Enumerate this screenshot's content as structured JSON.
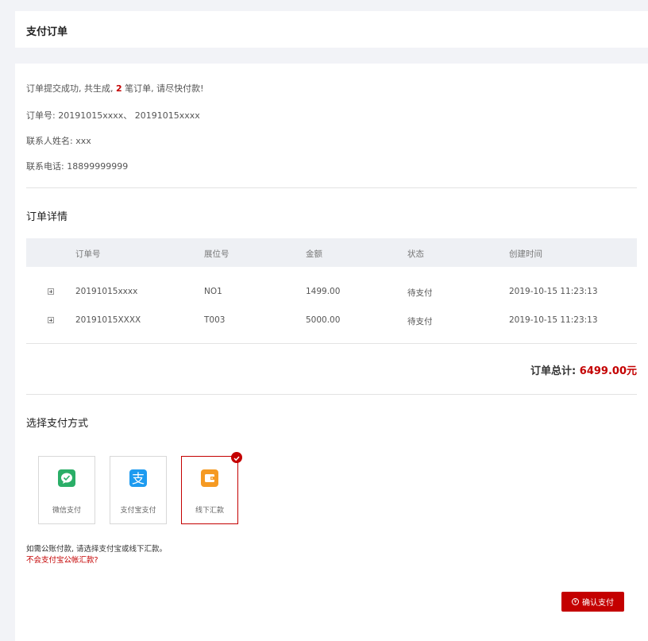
{
  "header": {
    "title": "支付订单"
  },
  "summary": {
    "line_prefix": "订单提交成功, 共生成,",
    "order_count": "2",
    "line_suffix": "笔订单, 请尽快付款!",
    "order_no_label": "订单号:",
    "order_no_value": "20191015xxxx、 20191015xxxx",
    "contact_name_label": "联系人姓名:",
    "contact_name_value": "xxx",
    "contact_phone_label": "联系电话:",
    "contact_phone_value": "18899999999"
  },
  "order_detail": {
    "title": "订单详情",
    "columns": [
      "订单号",
      "展位号",
      "金额",
      "状态",
      "创建时间"
    ],
    "rows": [
      {
        "order_no": "20191015xxxx",
        "booth": "NO1",
        "amount": "1499.00",
        "status": "待支付",
        "created": "2019-10-15 11:23:13"
      },
      {
        "order_no": "20191015XXXX",
        "booth": "T003",
        "amount": "5000.00",
        "status": "待支付",
        "created": "2019-10-15 11:23:13"
      }
    ]
  },
  "total": {
    "label": "订单总计:",
    "amount": "6499.00元"
  },
  "payment": {
    "title": "选择支付方式",
    "options": [
      {
        "label": "微信支付",
        "icon": "wechat-pay-icon",
        "color": "#2aae67"
      },
      {
        "label": "支付宝支付",
        "icon": "alipay-icon",
        "color": "#1d9bf0"
      },
      {
        "label": "线下汇款",
        "icon": "wallet-icon",
        "color": "#f59a23",
        "selected": true
      }
    ],
    "note": "如需公账付款, 请选择支付宝或线下汇款。",
    "help_link": "不会支付宝公帐汇款?"
  },
  "confirm_button": {
    "label": "确认支付",
    "icon": "yen-circle-icon"
  },
  "colors": {
    "accent": "#c40000",
    "background": "#f2f3f7",
    "table_header": "#eef0f4"
  }
}
